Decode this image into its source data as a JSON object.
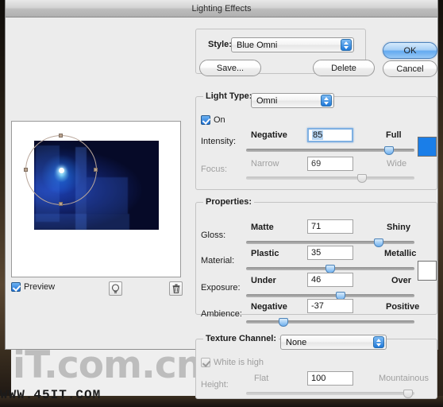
{
  "window": {
    "title": "Lighting Effects"
  },
  "style_group": {
    "label": "Style:",
    "selected": "Blue Omni",
    "save_label": "Save...",
    "delete_label": "Delete"
  },
  "actions": {
    "ok_label": "OK",
    "cancel_label": "Cancel"
  },
  "preview": {
    "checkbox_label": "Preview",
    "checked": true,
    "light_icon": "lightbulb-icon",
    "trash_icon": "trash-icon"
  },
  "light_type": {
    "group_title": "Light Type:",
    "selected": "Omni",
    "on_label": "On",
    "on_checked": true,
    "intensity": {
      "label": "Intensity:",
      "min_label": "Negative",
      "max_label": "Full",
      "value": "85",
      "percent": 85,
      "enabled": true
    },
    "focus": {
      "label": "Focus:",
      "min_label": "Narrow",
      "max_label": "Wide",
      "value": "69",
      "percent": 69,
      "enabled": false
    },
    "light_color": "#1a7ee8"
  },
  "properties": {
    "group_title": "Properties:",
    "rows": [
      {
        "label": "Gloss:",
        "min_label": "Matte",
        "max_label": "Shiny",
        "value": "71",
        "percent": 79
      },
      {
        "label": "Material:",
        "min_label": "Plastic",
        "max_label": "Metallic",
        "value": "35",
        "percent": 50
      },
      {
        "label": "Exposure:",
        "min_label": "Under",
        "max_label": "Over",
        "value": "46",
        "percent": 56
      },
      {
        "label": "Ambience:",
        "min_label": "Negative",
        "max_label": "Positive",
        "value": "-37",
        "percent": 22
      }
    ],
    "material_color": "#ffffff"
  },
  "texture": {
    "group_title": "Texture Channel:",
    "selected": "None",
    "white_is_high_label": "White is high",
    "white_is_high_checked": true,
    "height": {
      "label": "Height:",
      "min_label": "Flat",
      "max_label": "Mountainous",
      "value": "100",
      "percent": 96
    }
  },
  "watermark": {
    "logo": "iT.com.cn",
    "url": "WWW.45IT.COM"
  }
}
